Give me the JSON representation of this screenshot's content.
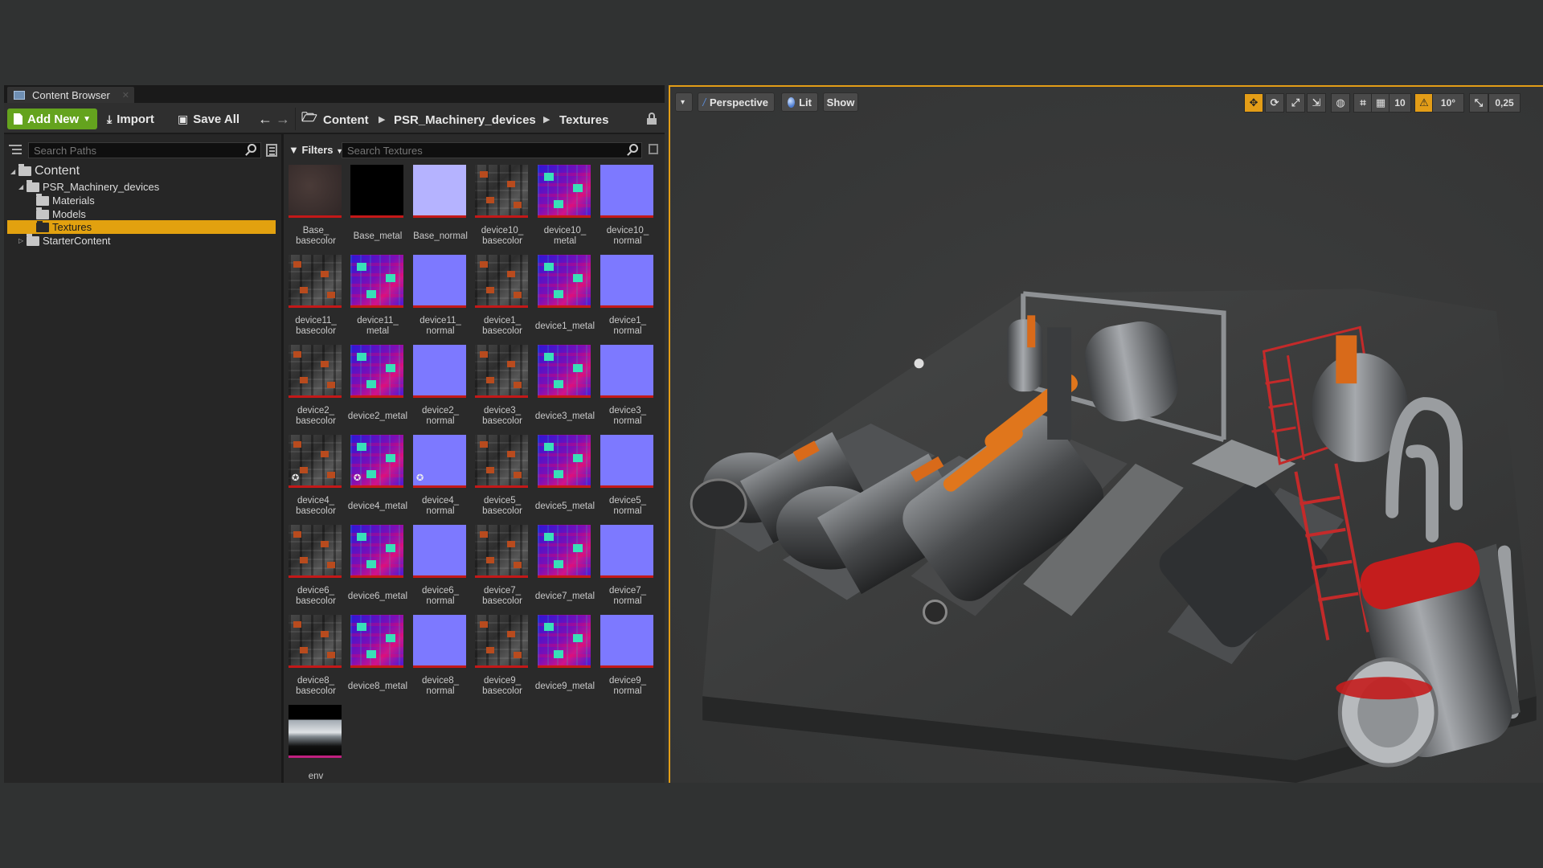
{
  "content_browser": {
    "tab_title": "Content Browser",
    "toolbar": {
      "add_new": "Add New",
      "import": "Import",
      "save_all": "Save All"
    },
    "breadcrumb": [
      "Content",
      "PSR_Machinery_devices",
      "Textures"
    ],
    "path_search_placeholder": "Search Paths",
    "asset_search_placeholder": "Search Textures",
    "filters_label": "Filters",
    "tree": [
      {
        "label": "Content",
        "level": 0,
        "expanded": true
      },
      {
        "label": "PSR_Machinery_devices",
        "level": 1,
        "expanded": true
      },
      {
        "label": "Materials",
        "level": 2
      },
      {
        "label": "Models",
        "level": 2
      },
      {
        "label": "Textures",
        "level": 2,
        "selected": true
      },
      {
        "label": "StarterContent",
        "level": 1,
        "expanded": false
      }
    ],
    "assets": [
      {
        "name": "Base_\nbasecolor",
        "kind": "basecolor0"
      },
      {
        "name": "Base_metal",
        "kind": "basemetal"
      },
      {
        "name": "Base_normal",
        "kind": "basenormal"
      },
      {
        "name": "device10_\nbasecolor",
        "kind": "basecolor"
      },
      {
        "name": "device10_\nmetal",
        "kind": "metal"
      },
      {
        "name": "device10_\nnormal",
        "kind": "normal"
      },
      {
        "name": "device11_\nbasecolor",
        "kind": "basecolor"
      },
      {
        "name": "device11_\nmetal",
        "kind": "metal"
      },
      {
        "name": "device11_\nnormal",
        "kind": "normal"
      },
      {
        "name": "device1_\nbasecolor",
        "kind": "basecolor"
      },
      {
        "name": "device1_metal",
        "kind": "metal"
      },
      {
        "name": "device1_\nnormal",
        "kind": "normal"
      },
      {
        "name": "device2_\nbasecolor",
        "kind": "basecolor"
      },
      {
        "name": "device2_metal",
        "kind": "metal"
      },
      {
        "name": "device2_\nnormal",
        "kind": "normal"
      },
      {
        "name": "device3_\nbasecolor",
        "kind": "basecolor"
      },
      {
        "name": "device3_metal",
        "kind": "metal"
      },
      {
        "name": "device3_\nnormal",
        "kind": "normal"
      },
      {
        "name": "device4_\nbasecolor",
        "kind": "basecolor",
        "star": true
      },
      {
        "name": "device4_metal",
        "kind": "metal",
        "star": true
      },
      {
        "name": "device4_\nnormal",
        "kind": "normal",
        "star": true
      },
      {
        "name": "device5_\nbasecolor",
        "kind": "basecolor"
      },
      {
        "name": "device5_metal",
        "kind": "metal"
      },
      {
        "name": "device5_\nnormal",
        "kind": "normal"
      },
      {
        "name": "device6_\nbasecolor",
        "kind": "basecolor"
      },
      {
        "name": "device6_metal",
        "kind": "metal"
      },
      {
        "name": "device6_\nnormal",
        "kind": "normal"
      },
      {
        "name": "device7_\nbasecolor",
        "kind": "basecolor"
      },
      {
        "name": "device7_metal",
        "kind": "metal"
      },
      {
        "name": "device7_\nnormal",
        "kind": "normal"
      },
      {
        "name": "device8_\nbasecolor",
        "kind": "basecolor"
      },
      {
        "name": "device8_metal",
        "kind": "metal"
      },
      {
        "name": "device8_\nnormal",
        "kind": "normal"
      },
      {
        "name": "device9_\nbasecolor",
        "kind": "basecolor"
      },
      {
        "name": "device9_metal",
        "kind": "metal"
      },
      {
        "name": "device9_\nnormal",
        "kind": "normal"
      },
      {
        "name": "env",
        "kind": "env"
      }
    ]
  },
  "viewport": {
    "menu": "▾",
    "perspective": "Perspective",
    "lit": "Lit",
    "show": "Show",
    "grid_snap": "10",
    "rotation_snap": "10°",
    "scale_snap": "0,25"
  },
  "colors": {
    "accent": "#e39d17",
    "add_new_green": "#64a31e",
    "texture_bar_red": "#c41818"
  }
}
